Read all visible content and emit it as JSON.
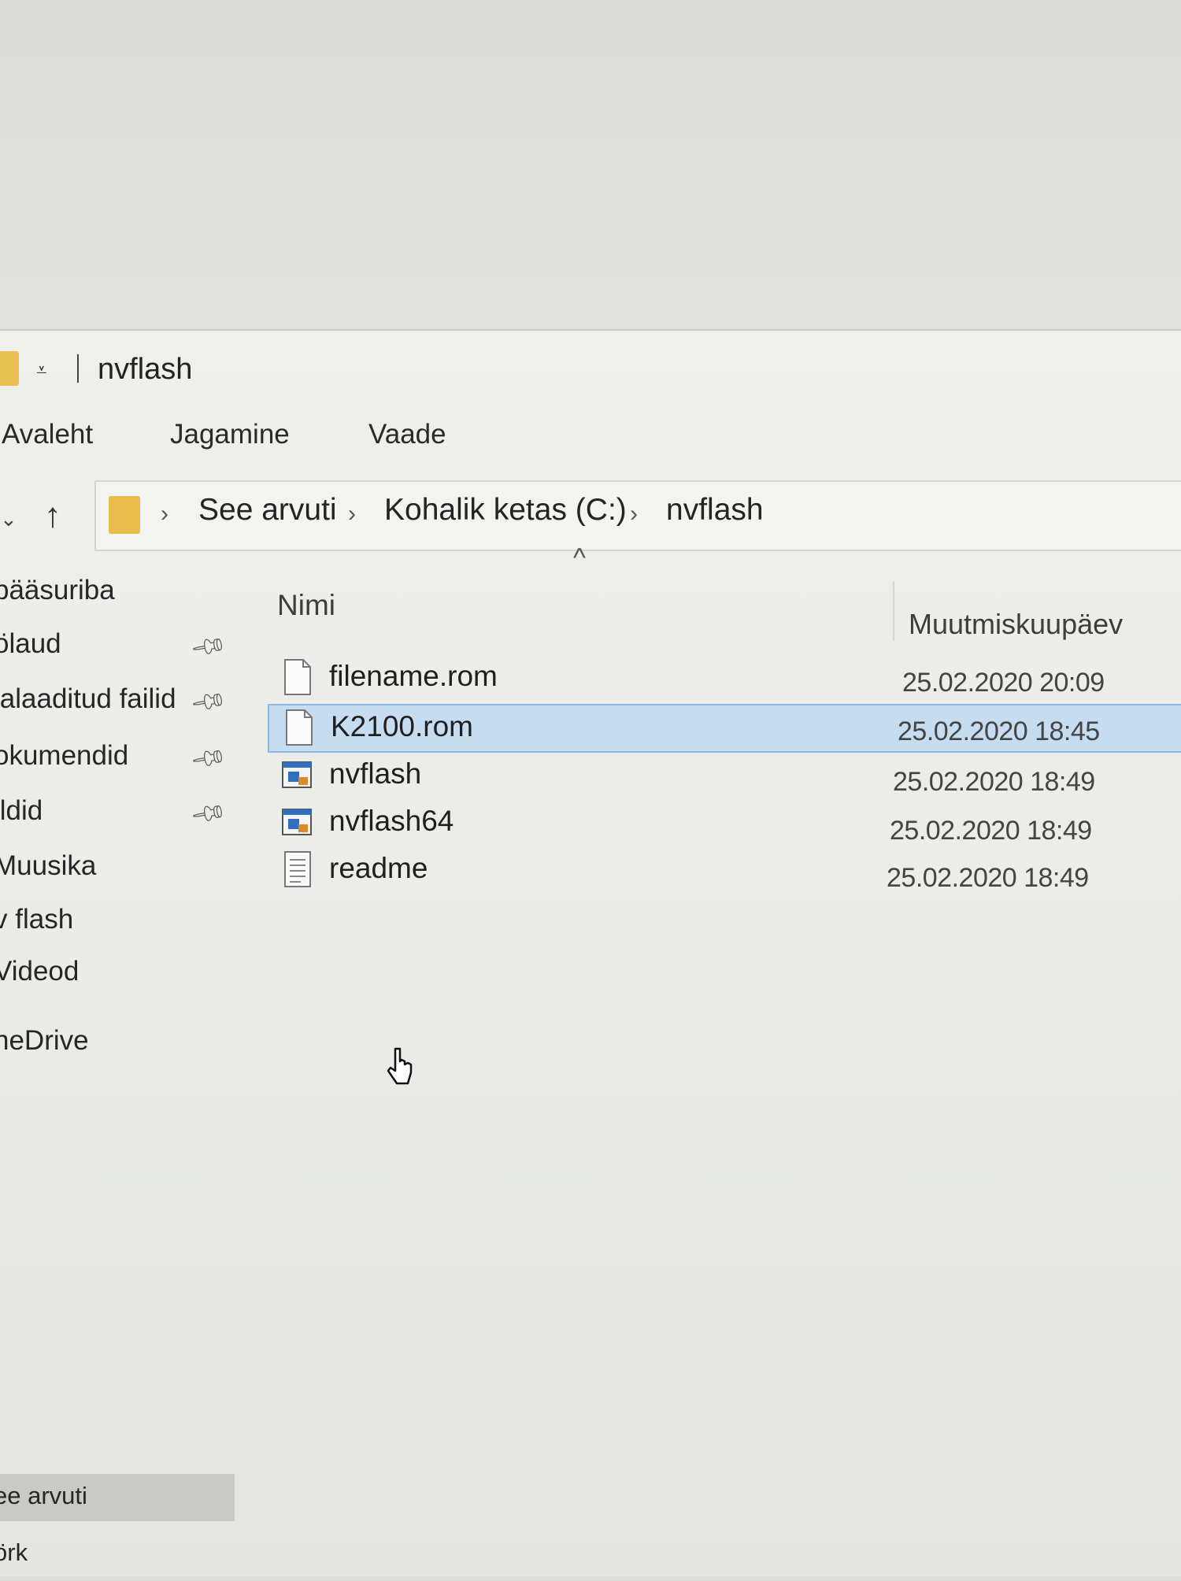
{
  "window": {
    "title": "nvflash",
    "quick_access_toolbar_icon": "dropdown-arrow-icon"
  },
  "ribbon": {
    "tabs": [
      {
        "label": "Avaleht"
      },
      {
        "label": "Jagamine"
      },
      {
        "label": "Vaade"
      }
    ]
  },
  "address_bar": {
    "breadcrumbs": [
      "See arvuti",
      "Kohalik ketas (C:)",
      "nvflash"
    ],
    "separator": "›"
  },
  "sidebar": {
    "items": [
      {
        "label": "pääsuriba",
        "pinned": false
      },
      {
        "label": "ölaud",
        "pinned": true
      },
      {
        "label": "lalaaditud failid",
        "pinned": true
      },
      {
        "label": "okumendid",
        "pinned": true
      },
      {
        "label": "ildid",
        "pinned": true
      },
      {
        "label": "Muusika",
        "pinned": false
      },
      {
        "label": "v flash",
        "pinned": false
      },
      {
        "label": "Videod",
        "pinned": false
      },
      {
        "label": "neDrive",
        "pinned": false
      },
      {
        "label": "ee arvuti",
        "pinned": false,
        "selected": true
      },
      {
        "label": "örk",
        "pinned": false
      }
    ]
  },
  "file_list": {
    "columns": {
      "name": "Nimi",
      "date": "Muutmiskuupäev"
    },
    "sort": {
      "column": "name",
      "direction": "ascending"
    },
    "files": [
      {
        "name": "filename.rom",
        "date": "25.02.2020 20:09",
        "icon": "blank-file-icon",
        "selected": false
      },
      {
        "name": "K2100.rom",
        "date": "25.02.2020 18:45",
        "icon": "blank-file-icon",
        "selected": true
      },
      {
        "name": "nvflash",
        "date": "25.02.2020 18:49",
        "icon": "application-icon",
        "selected": false
      },
      {
        "name": "nvflash64",
        "date": "25.02.2020 18:49",
        "icon": "application-icon",
        "selected": false
      },
      {
        "name": "readme",
        "date": "25.02.2020 18:49",
        "icon": "text-document-icon",
        "selected": false
      }
    ]
  },
  "colors": {
    "selection_fill": "#c6ddf1",
    "selection_border": "#8cb9df",
    "folder": "#e8bc4d"
  }
}
